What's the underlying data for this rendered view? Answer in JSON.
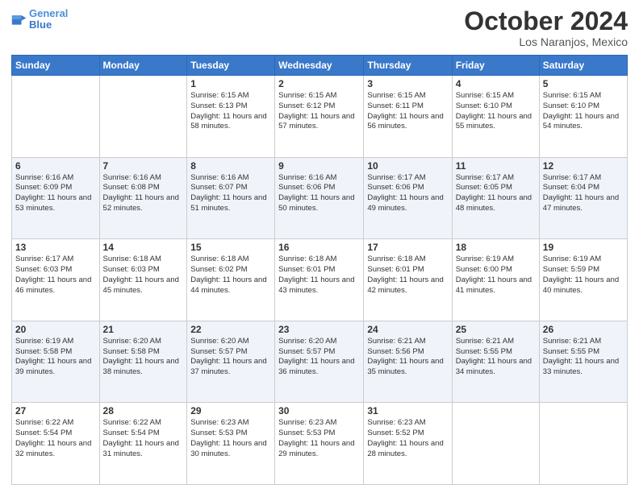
{
  "header": {
    "logo_line1": "General",
    "logo_line2": "Blue",
    "month": "October 2024",
    "location": "Los Naranjos, Mexico"
  },
  "weekdays": [
    "Sunday",
    "Monday",
    "Tuesday",
    "Wednesday",
    "Thursday",
    "Friday",
    "Saturday"
  ],
  "weeks": [
    [
      {
        "day": "",
        "info": ""
      },
      {
        "day": "",
        "info": ""
      },
      {
        "day": "1",
        "info": "Sunrise: 6:15 AM\nSunset: 6:13 PM\nDaylight: 11 hours and 58 minutes."
      },
      {
        "day": "2",
        "info": "Sunrise: 6:15 AM\nSunset: 6:12 PM\nDaylight: 11 hours and 57 minutes."
      },
      {
        "day": "3",
        "info": "Sunrise: 6:15 AM\nSunset: 6:11 PM\nDaylight: 11 hours and 56 minutes."
      },
      {
        "day": "4",
        "info": "Sunrise: 6:15 AM\nSunset: 6:10 PM\nDaylight: 11 hours and 55 minutes."
      },
      {
        "day": "5",
        "info": "Sunrise: 6:15 AM\nSunset: 6:10 PM\nDaylight: 11 hours and 54 minutes."
      }
    ],
    [
      {
        "day": "6",
        "info": "Sunrise: 6:16 AM\nSunset: 6:09 PM\nDaylight: 11 hours and 53 minutes."
      },
      {
        "day": "7",
        "info": "Sunrise: 6:16 AM\nSunset: 6:08 PM\nDaylight: 11 hours and 52 minutes."
      },
      {
        "day": "8",
        "info": "Sunrise: 6:16 AM\nSunset: 6:07 PM\nDaylight: 11 hours and 51 minutes."
      },
      {
        "day": "9",
        "info": "Sunrise: 6:16 AM\nSunset: 6:06 PM\nDaylight: 11 hours and 50 minutes."
      },
      {
        "day": "10",
        "info": "Sunrise: 6:17 AM\nSunset: 6:06 PM\nDaylight: 11 hours and 49 minutes."
      },
      {
        "day": "11",
        "info": "Sunrise: 6:17 AM\nSunset: 6:05 PM\nDaylight: 11 hours and 48 minutes."
      },
      {
        "day": "12",
        "info": "Sunrise: 6:17 AM\nSunset: 6:04 PM\nDaylight: 11 hours and 47 minutes."
      }
    ],
    [
      {
        "day": "13",
        "info": "Sunrise: 6:17 AM\nSunset: 6:03 PM\nDaylight: 11 hours and 46 minutes."
      },
      {
        "day": "14",
        "info": "Sunrise: 6:18 AM\nSunset: 6:03 PM\nDaylight: 11 hours and 45 minutes."
      },
      {
        "day": "15",
        "info": "Sunrise: 6:18 AM\nSunset: 6:02 PM\nDaylight: 11 hours and 44 minutes."
      },
      {
        "day": "16",
        "info": "Sunrise: 6:18 AM\nSunset: 6:01 PM\nDaylight: 11 hours and 43 minutes."
      },
      {
        "day": "17",
        "info": "Sunrise: 6:18 AM\nSunset: 6:01 PM\nDaylight: 11 hours and 42 minutes."
      },
      {
        "day": "18",
        "info": "Sunrise: 6:19 AM\nSunset: 6:00 PM\nDaylight: 11 hours and 41 minutes."
      },
      {
        "day": "19",
        "info": "Sunrise: 6:19 AM\nSunset: 5:59 PM\nDaylight: 11 hours and 40 minutes."
      }
    ],
    [
      {
        "day": "20",
        "info": "Sunrise: 6:19 AM\nSunset: 5:58 PM\nDaylight: 11 hours and 39 minutes."
      },
      {
        "day": "21",
        "info": "Sunrise: 6:20 AM\nSunset: 5:58 PM\nDaylight: 11 hours and 38 minutes."
      },
      {
        "day": "22",
        "info": "Sunrise: 6:20 AM\nSunset: 5:57 PM\nDaylight: 11 hours and 37 minutes."
      },
      {
        "day": "23",
        "info": "Sunrise: 6:20 AM\nSunset: 5:57 PM\nDaylight: 11 hours and 36 minutes."
      },
      {
        "day": "24",
        "info": "Sunrise: 6:21 AM\nSunset: 5:56 PM\nDaylight: 11 hours and 35 minutes."
      },
      {
        "day": "25",
        "info": "Sunrise: 6:21 AM\nSunset: 5:55 PM\nDaylight: 11 hours and 34 minutes."
      },
      {
        "day": "26",
        "info": "Sunrise: 6:21 AM\nSunset: 5:55 PM\nDaylight: 11 hours and 33 minutes."
      }
    ],
    [
      {
        "day": "27",
        "info": "Sunrise: 6:22 AM\nSunset: 5:54 PM\nDaylight: 11 hours and 32 minutes."
      },
      {
        "day": "28",
        "info": "Sunrise: 6:22 AM\nSunset: 5:54 PM\nDaylight: 11 hours and 31 minutes."
      },
      {
        "day": "29",
        "info": "Sunrise: 6:23 AM\nSunset: 5:53 PM\nDaylight: 11 hours and 30 minutes."
      },
      {
        "day": "30",
        "info": "Sunrise: 6:23 AM\nSunset: 5:53 PM\nDaylight: 11 hours and 29 minutes."
      },
      {
        "day": "31",
        "info": "Sunrise: 6:23 AM\nSunset: 5:52 PM\nDaylight: 11 hours and 28 minutes."
      },
      {
        "day": "",
        "info": ""
      },
      {
        "day": "",
        "info": ""
      }
    ]
  ]
}
